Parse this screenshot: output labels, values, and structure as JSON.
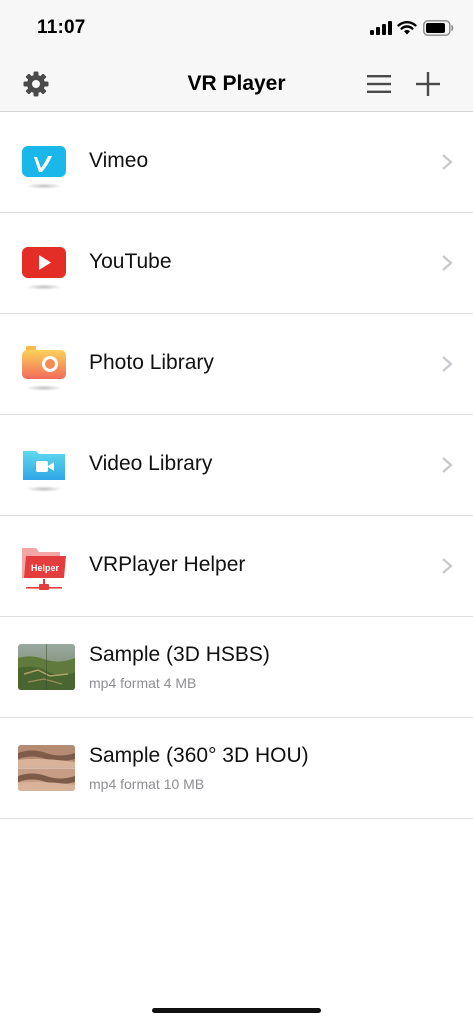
{
  "status": {
    "time": "11:07"
  },
  "nav": {
    "title": "VR Player",
    "settings_icon": "gear-icon",
    "list_icon": "list-icon",
    "add_icon": "plus-icon"
  },
  "sources": [
    {
      "label": "Vimeo",
      "icon": "vimeo-icon",
      "color": "#19b7ea"
    },
    {
      "label": "YouTube",
      "icon": "youtube-icon",
      "color": "#e52d27"
    },
    {
      "label": "Photo Library",
      "icon": "camera-icon",
      "color": "#f7a33b"
    },
    {
      "label": "Video Library",
      "icon": "video-folder-icon",
      "color": "#35b8e8"
    },
    {
      "label": "VRPlayer Helper",
      "icon": "helper-folder-icon",
      "color": "#e33d3d",
      "badge": "Helper"
    }
  ],
  "samples": [
    {
      "title": "Sample (3D HSBS)",
      "subtitle": "mp4 format 4 MB"
    },
    {
      "title": "Sample (360° 3D HOU)",
      "subtitle": "mp4 format 10 MB"
    }
  ],
  "colors": {
    "chevron": "#c7c7cc",
    "separator": "#dedede",
    "navbar_bg": "#f7f7f7"
  }
}
